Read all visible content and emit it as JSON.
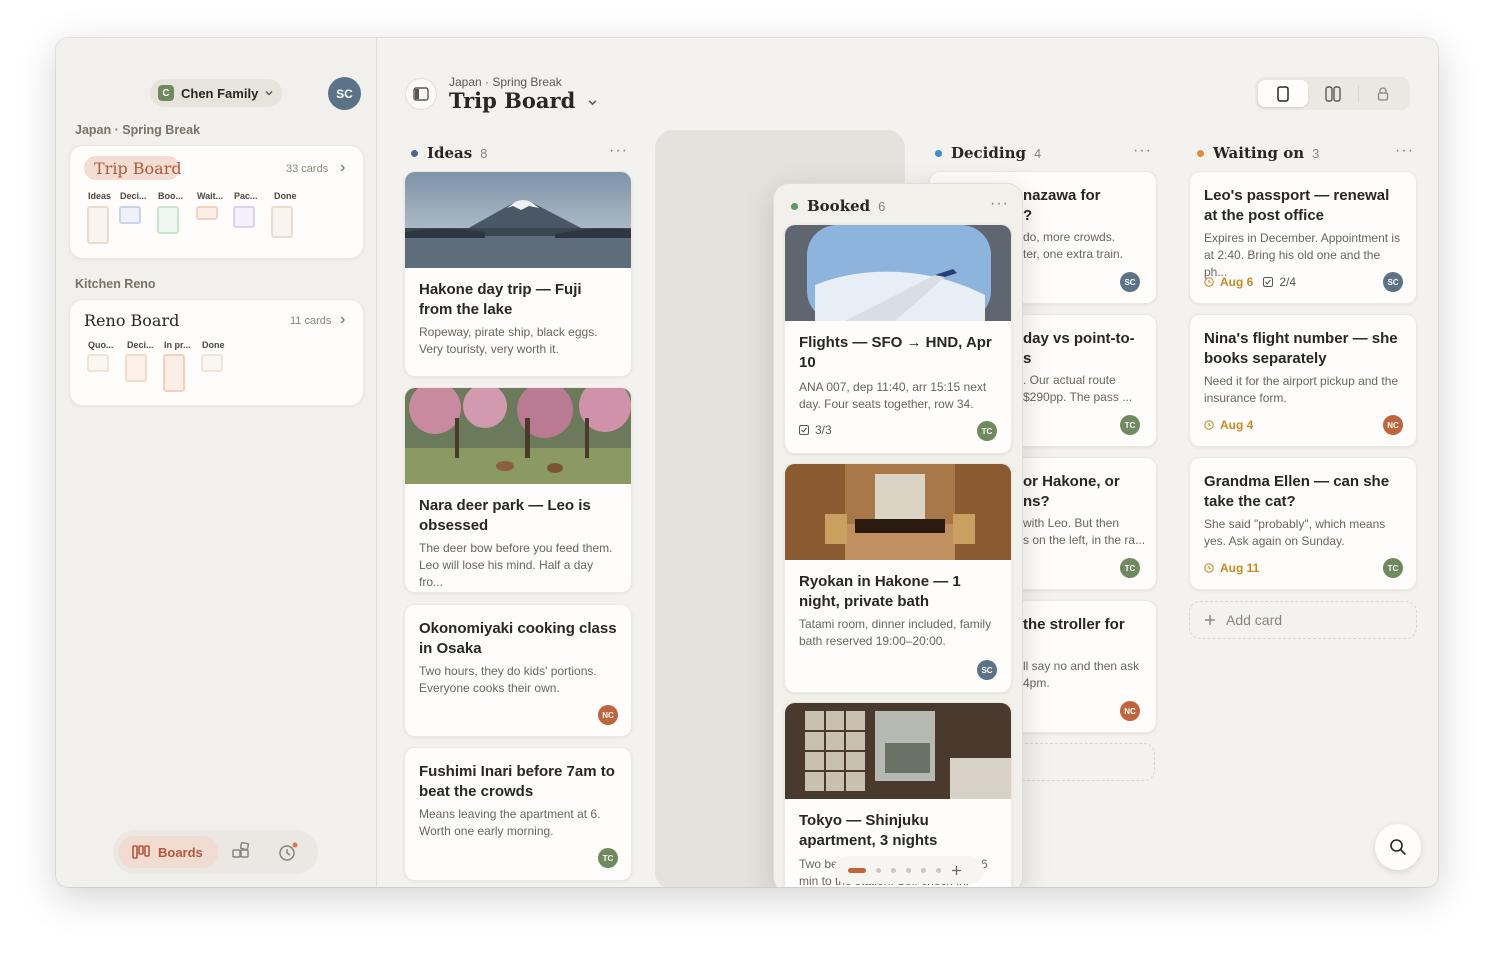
{
  "sidebar": {
    "family_initial": "C",
    "family_name": "Chen Family",
    "user_avatar": "SC",
    "section1": "Japan · Spring Break",
    "trip_board": {
      "title": "Trip Board",
      "count": "33 cards",
      "cols": [
        "Ideas",
        "Deci...",
        "Boo...",
        "Wait...",
        "Pac...",
        "Done"
      ]
    },
    "section2": "Kitchen Reno",
    "reno_board": {
      "title": "Reno Board",
      "count": "11 cards",
      "cols": [
        "Quo...",
        "Deci...",
        "In pr...",
        "Done"
      ]
    },
    "nav": {
      "boards": "Boards"
    }
  },
  "header": {
    "crumb": "Japan · Spring Break",
    "title": "Trip Board"
  },
  "colors": {
    "ideas": "#4e6a8a",
    "booked": "#5a9a5a",
    "deciding": "#3a8ad6",
    "waiting": "#e08a3c",
    "accent": "#b4573b"
  },
  "columns": {
    "ideas": {
      "name": "Ideas",
      "count": "8",
      "cards": [
        {
          "title": "Hakone day trip — Fuji from the lake",
          "desc": "Ropeway, pirate ship, black eggs. Very touristy, very worth it."
        },
        {
          "title": "Nara deer park — Leo is obsessed",
          "desc": "The deer bow before you feed them. Leo will lose his mind. Half a day fro..."
        },
        {
          "title": "Okonomiyaki cooking class in Osaka",
          "desc": "Two hours, they do kids' portions. Everyone cooks their own.",
          "avatar": "NC"
        },
        {
          "title": "Fushimi Inari before 7am to beat the crowds",
          "desc": "Means leaving the apartment at 6. Worth one early morning.",
          "avatar": "TC"
        }
      ]
    },
    "booked": {
      "name": "Booked",
      "count": "6",
      "cards": [
        {
          "title": "Flights — SFO → HND, Apr 10",
          "desc": "ANA 007, dep 11:40, arr 15:15 next day. Four seats together, row 34.",
          "check": "3/3",
          "avatar": "TC"
        },
        {
          "title": "Ryokan in Hakone — 1 night, private bath",
          "desc": "Tatami room, dinner included, family bath reserved 19:00–20:00.",
          "avatar": "SC"
        },
        {
          "title": "Tokyo — Shinjuku apartment, 3 nights",
          "desc_a": "Two be",
          "desc_b": "6",
          "desc2": "min to the station. Self check-in."
        }
      ]
    },
    "deciding": {
      "name": "Deciding",
      "count": "4",
      "cards": [
        {
          "t1": "nazawa for",
          "t2": "?",
          "d1": "do, more crowds.",
          "d2": "ter, one extra train.",
          "avatar": "SC"
        },
        {
          "t1": "day vs point-to-",
          "t2": "s",
          "d1": ". Our actual route",
          "d2": "$290pp. The pass ...",
          "avatar": "TC"
        },
        {
          "t1": "or Hakone, or",
          "t2": "ns?",
          "d1": "with Leo. But then",
          "d2": "s on the left, in the ra...",
          "avatar": "TC"
        },
        {
          "t1": "the stroller for",
          "d1": "ll say no and then ask",
          "d2": "4pm.",
          "avatar": "NC"
        }
      ]
    },
    "waiting": {
      "name": "Waiting on",
      "count": "3",
      "cards": [
        {
          "title": "Leo's passport — renewal at the post office",
          "desc": "Expires in December. Appointment is at 2:40. Bring his old one and the ph...",
          "date": "Aug 6",
          "check": "2/4",
          "avatar": "SC"
        },
        {
          "title": "Nina's flight number — she books separately",
          "desc": "Need it for the airport pickup and the insurance form.",
          "date": "Aug 4",
          "avatar": "NC"
        },
        {
          "title": "Grandma Ellen — can she take the cat?",
          "desc": "She said \"probably\", which means yes. Ask again on Sunday.",
          "date": "Aug 11",
          "avatar": "TC"
        }
      ],
      "add_label": "Add card"
    }
  },
  "icons": {
    "search": "search-icon",
    "sidebar_toggle": "sidebar-toggle-icon",
    "more": "more-icon"
  }
}
